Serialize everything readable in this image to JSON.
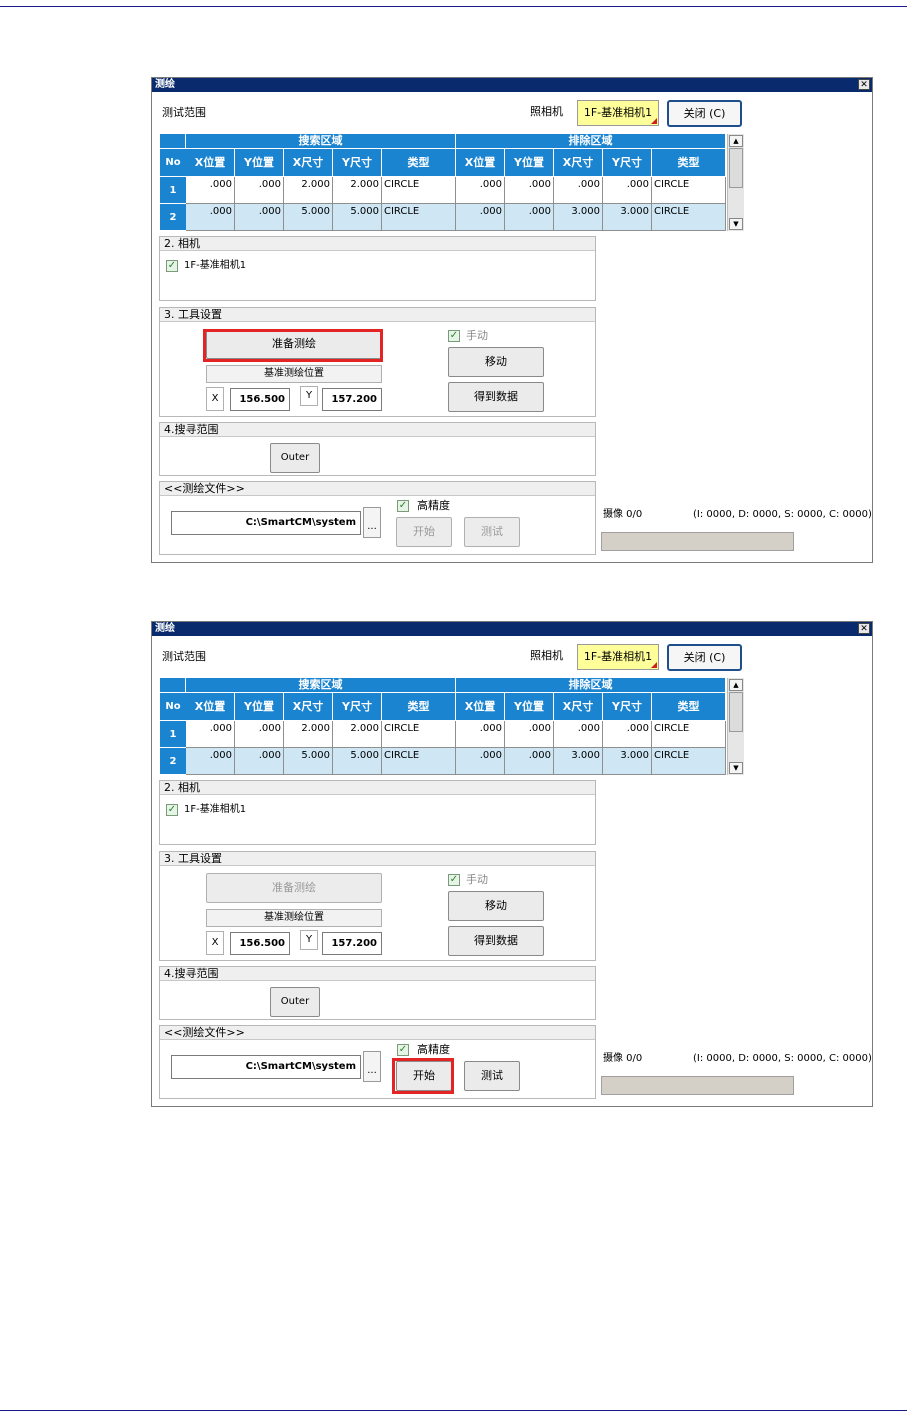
{
  "windows": [
    {
      "title": "测绘",
      "close_glyph": "✕",
      "range_label": "测试范围",
      "camera_label": "照相机",
      "camera_value": "1F-基准相机1",
      "close_button": "关闭 (C)",
      "table": {
        "no_header": "No",
        "search_group": "搜索区域",
        "exclude_group": "排除区域",
        "columns": [
          "X位置",
          "Y位置",
          "X尺寸",
          "Y尺寸",
          "类型",
          "X位置",
          "Y位置",
          "X尺寸",
          "Y尺寸",
          "类型"
        ],
        "rows": [
          {
            "no": "1",
            "cells": [
              ".000",
              ".000",
              "2.000",
              "2.000",
              "CIRCLE",
              ".000",
              ".000",
              ".000",
              ".000",
              "CIRCLE"
            ]
          },
          {
            "no": "2",
            "cells": [
              ".000",
              ".000",
              "5.000",
              "5.000",
              "CIRCLE",
              ".000",
              ".000",
              "3.000",
              "3.000",
              "CIRCLE"
            ]
          }
        ]
      },
      "camera_section": {
        "title": "2. 相机",
        "item": "1F-基准相机1"
      },
      "tool_section": {
        "title": "3. 工具设置",
        "prepare_button": "准备测绘",
        "manual_label": "手动",
        "move_button": "移动",
        "get_data_button": "得到数据",
        "ref_pos_label": "基准测绘位置",
        "x_label": "X",
        "x_value": "156.500",
        "y_label": "Y",
        "y_value": "157.200"
      },
      "search_section": {
        "title": "4.搜寻范围",
        "outer_button": "Outer"
      },
      "file_section": {
        "title": "<<测绘文件>>",
        "path": "C:\\SmartCM\\system",
        "browse": "...",
        "high_precision": "高精度",
        "start_button": "开始",
        "test_button": "测试"
      },
      "capture_label": "摄像 0/0",
      "capture_stats": "(I: 0000, D: 0000, S: 0000, C: 0000)"
    },
    {
      "title": "测绘",
      "close_glyph": "✕",
      "range_label": "测试范围",
      "camera_label": "照相机",
      "camera_value": "1F-基准相机1",
      "close_button": "关闭 (C)",
      "table": {
        "no_header": "No",
        "search_group": "搜索区域",
        "exclude_group": "排除区域",
        "columns": [
          "X位置",
          "Y位置",
          "X尺寸",
          "Y尺寸",
          "类型",
          "X位置",
          "Y位置",
          "X尺寸",
          "Y尺寸",
          "类型"
        ],
        "rows": [
          {
            "no": "1",
            "cells": [
              ".000",
              ".000",
              "2.000",
              "2.000",
              "CIRCLE",
              ".000",
              ".000",
              ".000",
              ".000",
              "CIRCLE"
            ]
          },
          {
            "no": "2",
            "cells": [
              ".000",
              ".000",
              "5.000",
              "5.000",
              "CIRCLE",
              ".000",
              ".000",
              "3.000",
              "3.000",
              "CIRCLE"
            ]
          }
        ]
      },
      "camera_section": {
        "title": "2. 相机",
        "item": "1F-基准相机1"
      },
      "tool_section": {
        "title": "3. 工具设置",
        "prepare_button": "准备测绘",
        "manual_label": "手动",
        "move_button": "移动",
        "get_data_button": "得到数据",
        "ref_pos_label": "基准测绘位置",
        "x_label": "X",
        "x_value": "156.500",
        "y_label": "Y",
        "y_value": "157.200"
      },
      "search_section": {
        "title": "4.搜寻范围",
        "outer_button": "Outer"
      },
      "file_section": {
        "title": "<<测绘文件>>",
        "path": "C:\\SmartCM\\system",
        "browse": "...",
        "high_precision": "高精度",
        "start_button": "开始",
        "test_button": "测试"
      },
      "capture_label": "摄像 0/0",
      "capture_stats": "(I: 0000, D: 0000, S: 0000, C: 0000)"
    }
  ],
  "colors": {
    "header_blue": "#1b84d0",
    "highlight_red": "#e32424",
    "camera_yellow": "#ffff99",
    "title_bar": "#0a2a6e"
  }
}
